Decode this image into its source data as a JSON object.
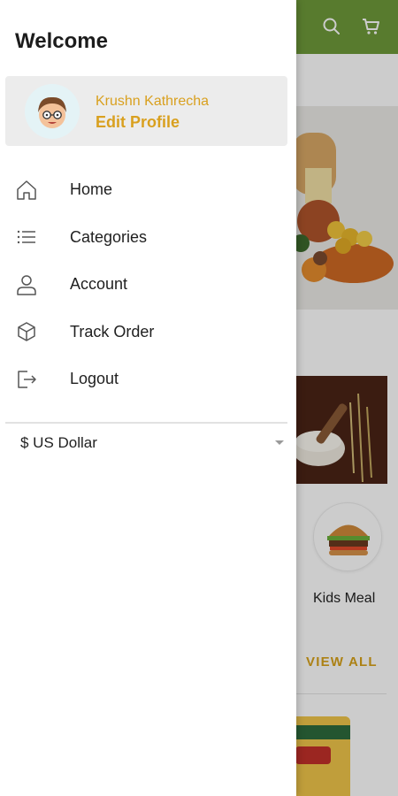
{
  "background": {
    "accent_color": "#6f9a3a",
    "category_label": "Kids Meal",
    "view_all_label": "VIEW ALL",
    "topbar_icons": [
      "search-icon",
      "cart-icon"
    ]
  },
  "drawer": {
    "title": "Welcome",
    "profile": {
      "name": "Krushn Kathrecha",
      "edit_label": "Edit Profile",
      "accent_color": "#d9a01f"
    },
    "menu": [
      {
        "label": "Home",
        "icon": "home-icon"
      },
      {
        "label": "Categories",
        "icon": "list-icon"
      },
      {
        "label": "Account",
        "icon": "user-icon"
      },
      {
        "label": "Track Order",
        "icon": "box-icon"
      },
      {
        "label": "Logout",
        "icon": "logout-icon"
      }
    ],
    "currency": {
      "selected": "$ US Dollar"
    }
  }
}
